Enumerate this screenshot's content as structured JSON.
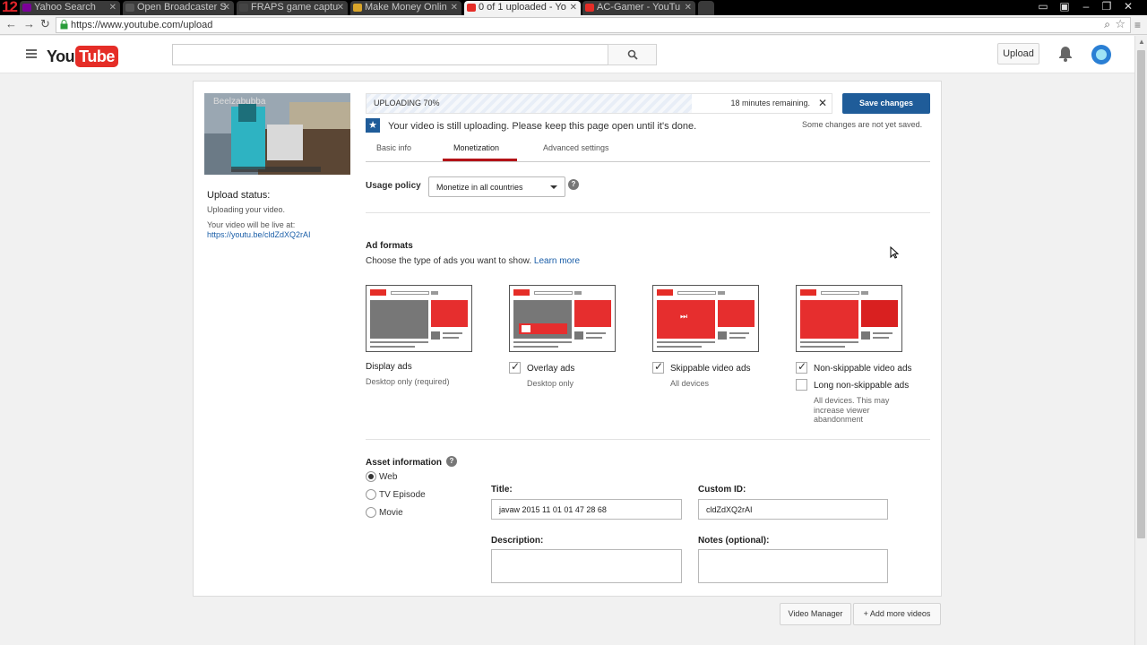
{
  "browser": {
    "tabs": [
      {
        "label": "Yahoo Search",
        "favicon_color": "#7b0099"
      },
      {
        "label": "Open Broadcaster S",
        "favicon_color": "#555555"
      },
      {
        "label": "FRAPS game captu",
        "favicon_color": "#444444"
      },
      {
        "label": "Make Money Onlin",
        "favicon_color": "#d9a52a"
      },
      {
        "label": "0 of 1 uploaded - Yo",
        "favicon_color": "#e52d27"
      },
      {
        "label": "AC-Gamer - YouTu",
        "favicon_color": "#e52d27"
      }
    ],
    "url": "https://www.youtube.com/upload"
  },
  "header": {
    "logo_you": "You",
    "logo_tube": "Tube",
    "search_placeholder": "",
    "upload_label": "Upload"
  },
  "sidebar": {
    "thumbnail_name": "Beelzabubba",
    "status_title": "Upload status:",
    "status_text": "Uploading your video.",
    "live_text": "Your video will be live at:",
    "live_link": "https://youtu.be/cldZdXQ2rAI"
  },
  "upload": {
    "progress_label": "UPLOADING 70%",
    "progress_value": 0.7,
    "remaining": "18 minutes remaining.",
    "save_label": "Save changes",
    "unsaved": "Some changes are not yet saved.",
    "message": "Your video is still uploading. Please keep this page open until it's done."
  },
  "tabs": {
    "basic": "Basic info",
    "monetization": "Monetization",
    "advanced": "Advanced settings"
  },
  "usage": {
    "label": "Usage policy",
    "value": "Monetize in all countries"
  },
  "ad_formats": {
    "title": "Ad formats",
    "desc": "Choose the type of ads you want to show.",
    "learn_more": "Learn more",
    "display": {
      "label": "Display ads",
      "sub": "Desktop only (required)"
    },
    "overlay": {
      "label": "Overlay ads",
      "sub": "Desktop only",
      "checked": true
    },
    "skippable": {
      "label": "Skippable video ads",
      "sub": "All devices",
      "checked": true
    },
    "nonskippable": {
      "label": "Non-skippable video ads",
      "checked": true
    },
    "long_nonskippable": {
      "label": "Long non-skippable ads",
      "checked": false,
      "sub1": "All devices. This may",
      "sub2": "increase viewer",
      "sub3": "abandonment"
    }
  },
  "asset": {
    "title": "Asset information",
    "types": [
      "Web",
      "TV Episode",
      "Movie"
    ],
    "selected": "Web",
    "title_label": "Title:",
    "title_value": "javaw 2015 11 01 01 47 28 68",
    "custom_id_label": "Custom ID:",
    "custom_id_value": "cldZdXQ2rAI",
    "description_label": "Description:",
    "notes_label": "Notes (optional):"
  },
  "footer": {
    "video_manager": "Video Manager",
    "add_more": "Add more videos"
  },
  "colors": {
    "accent": "#1f5c99",
    "brand_red": "#e52d27",
    "tab_underline": "#b31217",
    "link": "#1a5ea8"
  }
}
